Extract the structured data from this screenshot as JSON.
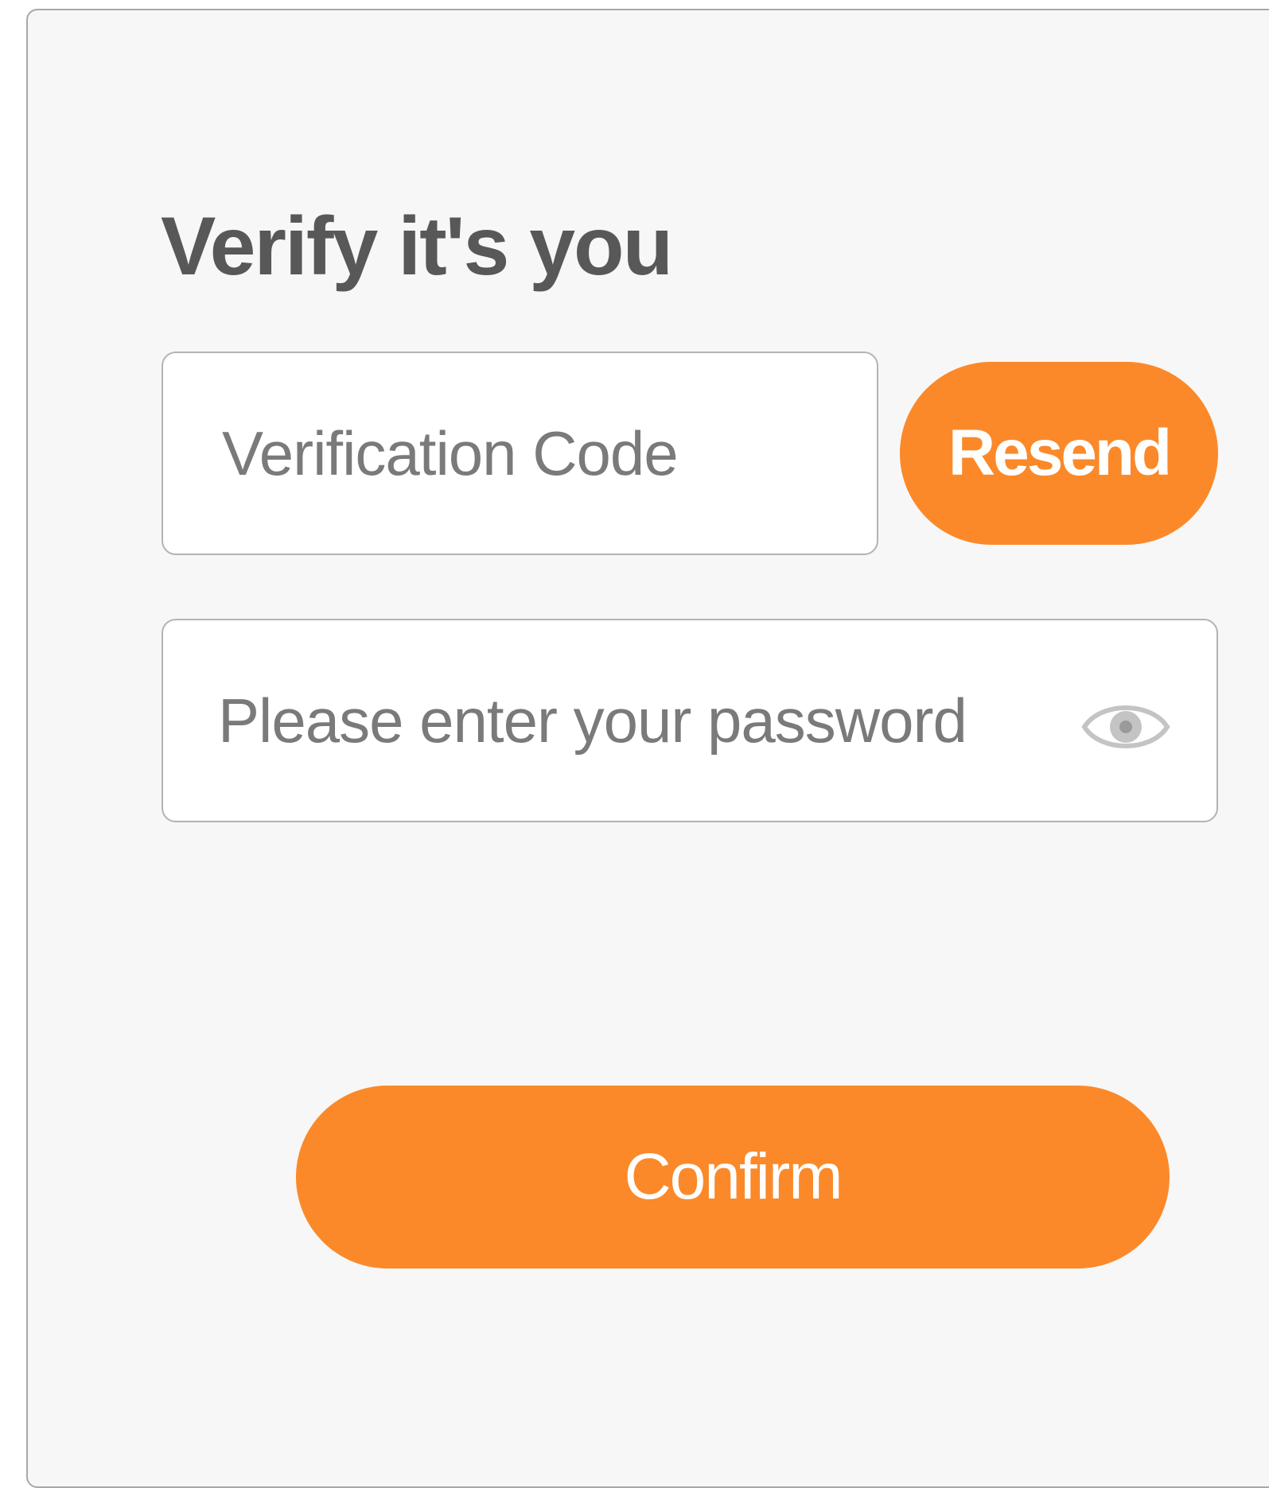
{
  "dialog": {
    "title": "Verify it's you"
  },
  "verification": {
    "code_placeholder": "Verification Code",
    "code_value": "",
    "resend_label": "Resend"
  },
  "password": {
    "placeholder": "Please enter your password",
    "value": "",
    "toggle_icon": "eye-icon"
  },
  "actions": {
    "confirm_label": "Confirm"
  },
  "colors": {
    "accent": "#fb8929",
    "title_text": "#585858",
    "placeholder_text": "#7a7a7a",
    "card_background": "#f7f7f7",
    "border": "#b3b3b3"
  }
}
